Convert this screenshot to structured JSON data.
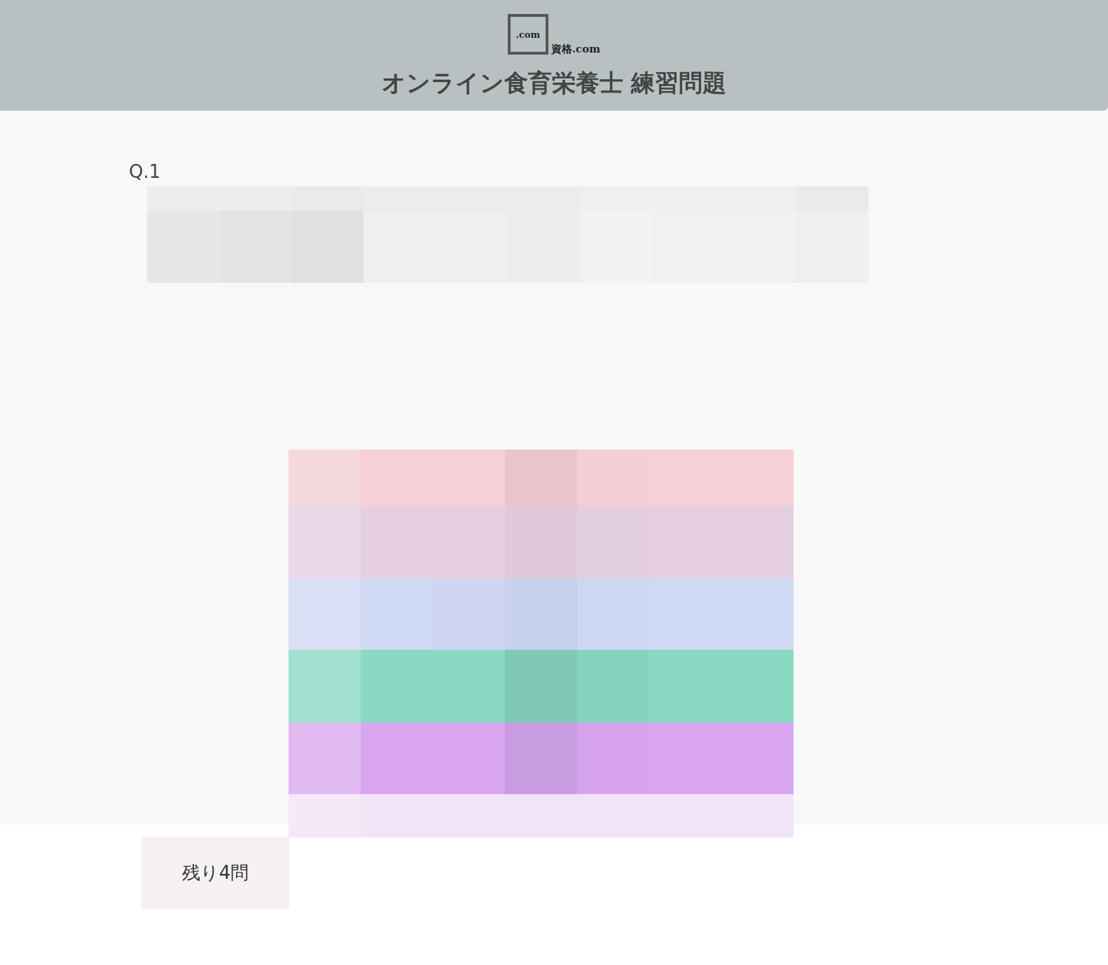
{
  "header": {
    "logo_mark": ".com",
    "logo_text": "資格.com",
    "title": "オンライン食育栄養士 練習問題"
  },
  "question": {
    "label": "Q.1"
  },
  "remaining": "残り4問"
}
